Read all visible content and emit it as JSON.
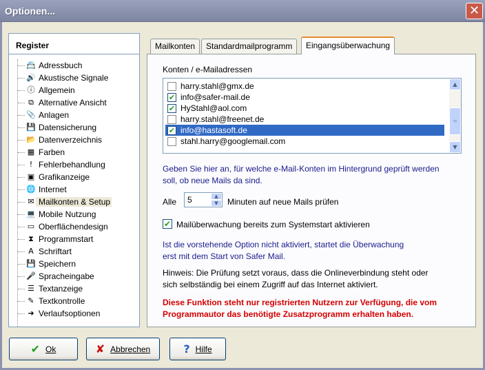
{
  "window": {
    "title": "Optionen..."
  },
  "register": {
    "header": "Register",
    "items": [
      {
        "label": "Adressbuch",
        "icon": "address-book-icon",
        "glyph": "📇"
      },
      {
        "label": "Akustische Signale",
        "icon": "speaker-icon",
        "glyph": "🔊"
      },
      {
        "label": "Allgemein",
        "icon": "info-icon",
        "glyph": "ⓘ"
      },
      {
        "label": "Alternative Ansicht",
        "icon": "view-icon",
        "glyph": "⧉"
      },
      {
        "label": "Anlagen",
        "icon": "paperclip-icon",
        "glyph": "📎"
      },
      {
        "label": "Datensicherung",
        "icon": "floppy-icon",
        "glyph": "💾"
      },
      {
        "label": "Datenverzeichnis",
        "icon": "folder-icon",
        "glyph": "📂"
      },
      {
        "label": "Farben",
        "icon": "color-palette-icon",
        "glyph": "▦"
      },
      {
        "label": "Fehlerbehandlung",
        "icon": "exclamation-icon",
        "glyph": "!"
      },
      {
        "label": "Grafikanzeige",
        "icon": "image-icon",
        "glyph": "▣"
      },
      {
        "label": "Internet",
        "icon": "globe-icon",
        "glyph": "🌐"
      },
      {
        "label": "Mailkonten & Setup",
        "icon": "mail-setup-icon",
        "glyph": "✉"
      },
      {
        "label": "Mobile Nutzung",
        "icon": "laptop-icon",
        "glyph": "💻"
      },
      {
        "label": "Oberflächendesign",
        "icon": "window-design-icon",
        "glyph": "▭"
      },
      {
        "label": "Programmstart",
        "icon": "hourglass-icon",
        "glyph": "⧗"
      },
      {
        "label": "Schriftart",
        "icon": "font-icon",
        "glyph": "A"
      },
      {
        "label": "Speichern",
        "icon": "save-icon",
        "glyph": "💾"
      },
      {
        "label": "Spracheingabe",
        "icon": "microphone-icon",
        "glyph": "🎤"
      },
      {
        "label": "Textanzeige",
        "icon": "text-document-icon",
        "glyph": "☰"
      },
      {
        "label": "Textkontrolle",
        "icon": "spellcheck-icon",
        "glyph": "✎"
      },
      {
        "label": "Verlaufsoptionen",
        "icon": "arrow-icon",
        "glyph": "➜"
      }
    ],
    "selected_index": 11
  },
  "tabs": [
    {
      "label": "Mailkonten"
    },
    {
      "label": "Standardmailprogramm"
    },
    {
      "label": "Eingangsüberwachung"
    }
  ],
  "active_tab": 2,
  "panel": {
    "accounts_label": "Konten / e-Mailadressen",
    "accounts": [
      {
        "email": "harry.stahl@gmx.de",
        "checked": false
      },
      {
        "email": "info@safer-mail.de",
        "checked": true
      },
      {
        "email": "HyStahl@aol.com",
        "checked": true
      },
      {
        "email": "harry.stahl@freenet.de",
        "checked": false
      },
      {
        "email": "info@hastasoft.de",
        "checked": true,
        "selected": true
      },
      {
        "email": "stahl.harry@googlemail.com",
        "checked": false
      }
    ],
    "info_line1": "Geben Sie hier an, für welche e-Mail-Konten im Hintergrund geprüft werden",
    "info_line2": "soll, ob neue Mails da sind.",
    "interval_prefix": "Alle",
    "interval_value": "5",
    "interval_suffix": "Minuten auf neue Mails prüfen",
    "startup_check_label": "Mailüberwachung bereits zum Systemstart aktivieren",
    "startup_checked": true,
    "note_line1": "Ist die vorstehende Option nicht aktiviert, startet die Überwachung",
    "note_line2": "erst mit dem Start von Safer Mail.",
    "hint_line1": "Hinweis: Die Prüfung setzt voraus, dass die Onlineverbindung steht oder",
    "hint_line2": "sich selbständig bei einem Zugriff auf das Internet aktiviert.",
    "warning_line1": "Diese Funktion steht nur registrierten Nutzern zur Verfügung, die vom",
    "warning_line2": "Programmautor das benötigte Zusatzprogramm erhalten haben."
  },
  "buttons": {
    "ok": "Ok",
    "cancel": "Abbrechen",
    "help": "Hilfe"
  },
  "colors": {
    "selection": "#316ac5",
    "check_green": "#21a121",
    "warning_red": "#d40000",
    "info_blue": "#1a1a8c"
  }
}
